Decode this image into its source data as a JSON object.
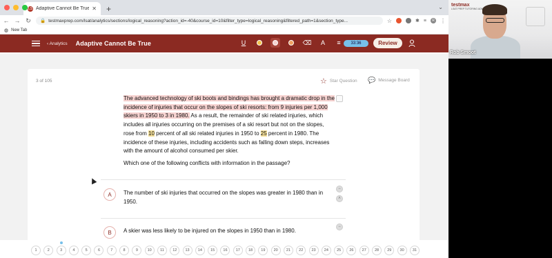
{
  "browser": {
    "tab_title": "Adaptive Cannot Be True",
    "tab_favicon": "LS",
    "url": "testmaxprep.com/lsat/analytics/sections/logical_reasoning?action_id=-40&course_id=10&filter_type=logical_reasoning&filtered_path=1&section_type...",
    "bookmark": "New Tab",
    "profile_initial": "R"
  },
  "app": {
    "back_label": "Analytics",
    "title": "Adaptive Cannot Be True",
    "timer": "33:36",
    "review_label": "Review",
    "accent": "#8b2a22",
    "timer_color": "#77c0ea"
  },
  "question": {
    "count": "3 of 105",
    "star_label": "Star Question",
    "message_label": "Message Board",
    "passage_p1": "The advanced technology of ski boots and bindings has brought a dramatic drop in the incidence of injuries that occur on the slopes of ski resorts: from 9 injuries per 1,000 skiers in 1950 to 3 in 1980.",
    "passage_p2a": " As a result, the remainder of ski related injuries, which includes all injuries occurring on the premises of a ski resort but not on the slopes, rose from ",
    "passage_num1": "10",
    "passage_p2b": " percent of all ski related injuries in 1950 to ",
    "passage_num2": "25",
    "passage_p2c": " percent in 1980. The incidence of these injuries, including accidents such as falling down steps, increases with the amount of alcohol consumed per skier.",
    "stem": "Which one of the following conflicts with information in the passage?",
    "choices": [
      {
        "letter": "A",
        "text": "The number of ski injuries that occurred on the slopes was greater in 1980 than in 1950."
      },
      {
        "letter": "B",
        "text": "A skier was less likely to be injured on the slopes in 1950 than in 1980."
      }
    ]
  },
  "pager": {
    "pages": [
      "1",
      "2",
      "3",
      "4",
      "5",
      "6",
      "7",
      "8",
      "9",
      "10",
      "11",
      "12",
      "13",
      "14",
      "15",
      "16",
      "17",
      "18",
      "19",
      "20",
      "21",
      "22",
      "23",
      "24",
      "25",
      "26",
      "27",
      "28",
      "29",
      "30",
      "31"
    ]
  },
  "video": {
    "presenter_name": "Rob Smoot",
    "logo_text": "testmax",
    "logo_sub": "LSAT PREP TUTORING ADMISSIONS"
  }
}
